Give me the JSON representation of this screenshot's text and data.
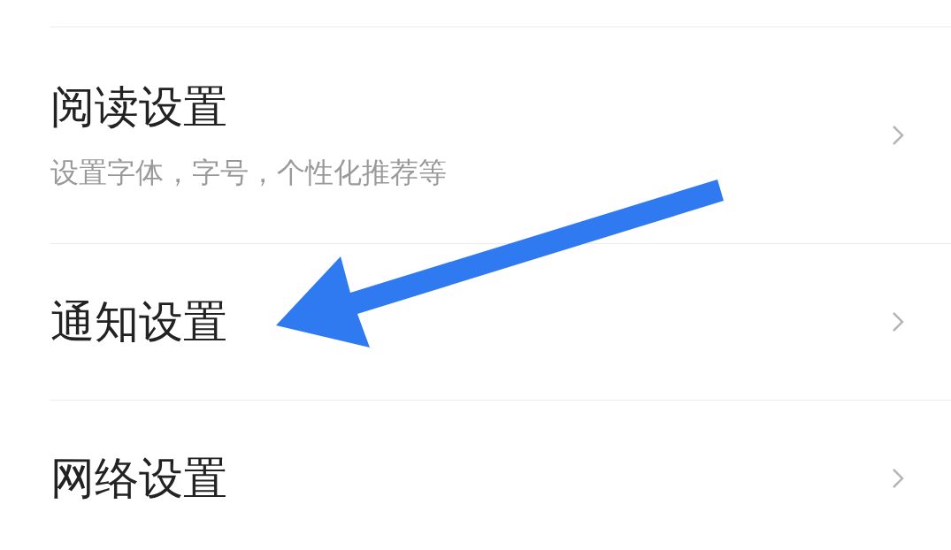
{
  "settings": [
    {
      "title": "阅读设置",
      "subtitle": "设置字体，字号，个性化推荐等"
    },
    {
      "title": "通知设置"
    },
    {
      "title": "网络设置"
    }
  ]
}
